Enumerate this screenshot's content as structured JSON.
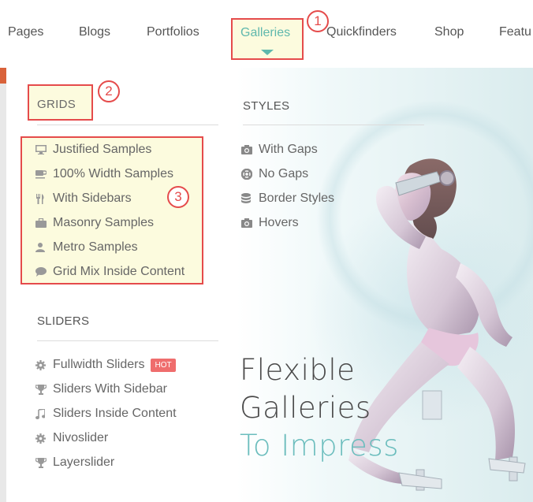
{
  "nav": {
    "items": [
      "Pages",
      "Blogs",
      "Portfolios",
      "Galleries",
      "Quickfinders",
      "Shop",
      "Featu"
    ],
    "active": "Galleries",
    "active_color": "#5fb8ad"
  },
  "annotations": [
    "1",
    "2",
    "3"
  ],
  "annotation_color": "#e54b4b",
  "grids": {
    "heading": "GRIDS",
    "items": [
      {
        "label": "Justified Samples",
        "icon": "monitor-icon"
      },
      {
        "label": "100% Width Samples",
        "icon": "coffee-cup-icon"
      },
      {
        "label": "With Sidebars",
        "icon": "fork-knife-icon"
      },
      {
        "label": "Masonry Samples",
        "icon": "briefcase-icon"
      },
      {
        "label": "Metro Samples",
        "icon": "user-icon"
      },
      {
        "label": "Grid Mix Inside Content",
        "icon": "speech-bubble-icon"
      }
    ]
  },
  "styles": {
    "heading": "STYLES",
    "items": [
      {
        "label": "With Gaps",
        "icon": "camera-icon"
      },
      {
        "label": "No Gaps",
        "icon": "lifebuoy-icon"
      },
      {
        "label": "Border Styles",
        "icon": "database-icon"
      },
      {
        "label": "Hovers",
        "icon": "camera-icon"
      }
    ]
  },
  "sliders": {
    "heading": "SLIDERS",
    "items": [
      {
        "label": "Fullwidth Sliders",
        "icon": "gear-icon",
        "badge": "HOT"
      },
      {
        "label": "Sliders With Sidebar",
        "icon": "trophy-icon"
      },
      {
        "label": "Sliders Inside Content",
        "icon": "music-note-icon"
      },
      {
        "label": "Nivoslider",
        "icon": "gear-icon"
      },
      {
        "label": "Layerslider",
        "icon": "trophy-icon"
      }
    ]
  },
  "promo": {
    "line1": "Flexible",
    "line2": "Galleries",
    "line3": "To Impress",
    "accent_color": "#6bbdbd"
  }
}
